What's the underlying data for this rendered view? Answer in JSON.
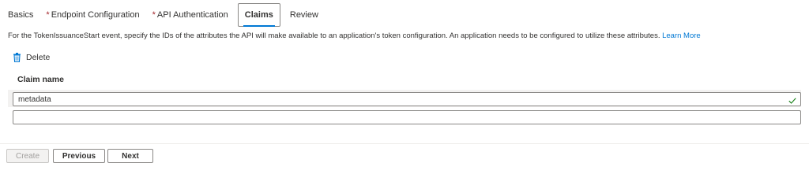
{
  "tabs": [
    {
      "label": "Basics",
      "required": false,
      "active": false
    },
    {
      "label": "Endpoint Configuration",
      "required": true,
      "active": false
    },
    {
      "label": "API Authentication",
      "required": true,
      "active": false
    },
    {
      "label": "Claims",
      "required": false,
      "active": true
    },
    {
      "label": "Review",
      "required": false,
      "active": false
    }
  ],
  "required_marker": "*",
  "description": {
    "text": "For the TokenIssuanceStart event, specify the IDs of the attributes the API will make available to an application's token configuration. An application needs to be configured to utilize these attributes.",
    "link": "Learn More"
  },
  "toolbar": {
    "delete_label": "Delete",
    "delete_icon": "trash-icon"
  },
  "table": {
    "column_header": "Claim name",
    "rows": [
      {
        "value": "metadata",
        "valid": true
      },
      {
        "value": "",
        "valid": false
      }
    ]
  },
  "footer": {
    "create_label": "Create",
    "previous_label": "Previous",
    "next_label": "Next"
  },
  "colors": {
    "accent": "#0078d4",
    "required": "#a4262c",
    "valid_check": "#107c10"
  }
}
